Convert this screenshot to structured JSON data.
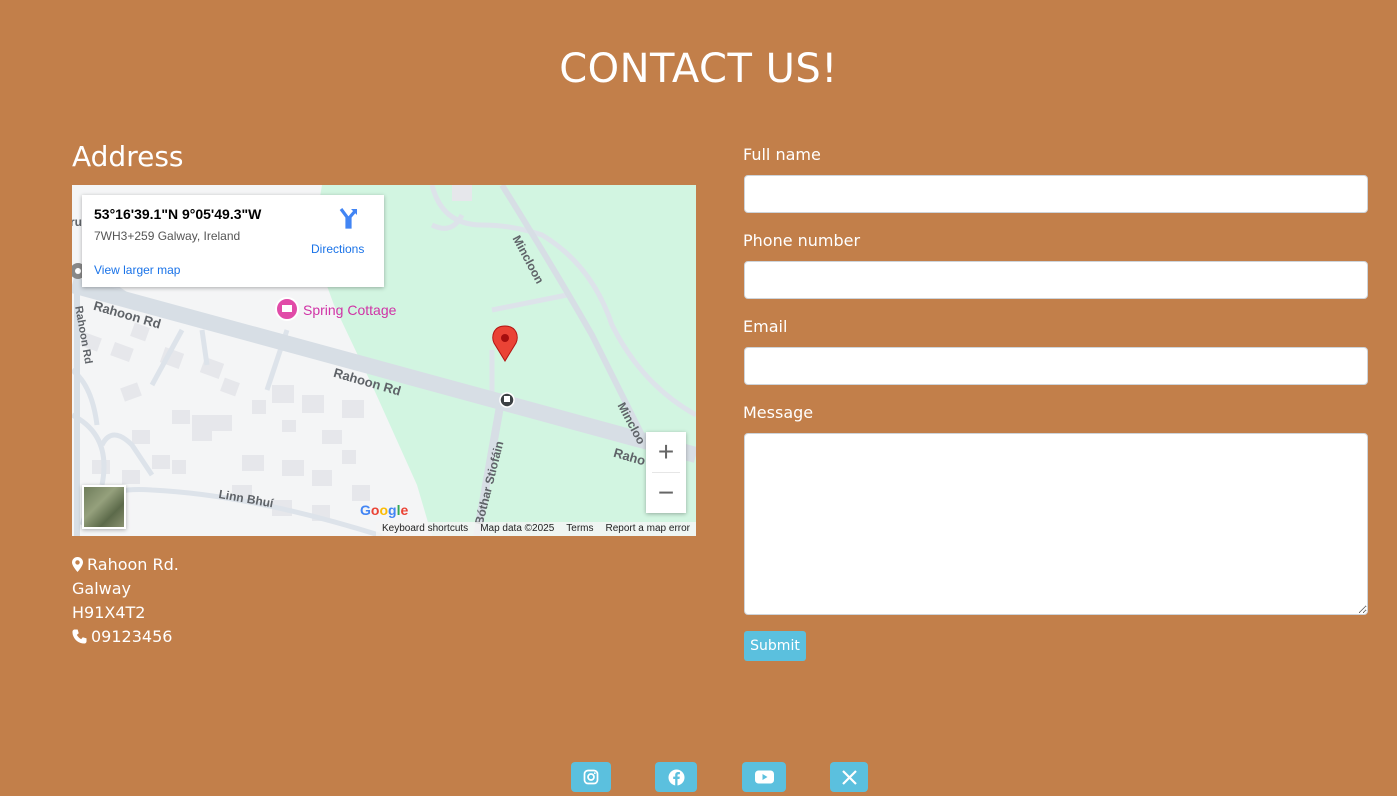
{
  "page": {
    "title": "CONTACT US!"
  },
  "address": {
    "heading": "Address",
    "street": "Rahoon Rd.",
    "city": "Galway",
    "postcode": "H91X4T2",
    "phone": "09123456"
  },
  "map": {
    "card": {
      "coords": "53°16'39.1\"N 9°05'49.3\"W",
      "plus_code": "7WH3+259 Galway, Ireland",
      "larger_map": "View larger map",
      "directions": "Directions"
    },
    "labels": {
      "poi": "Spring Cottage",
      "road_left": "Rahoon Rd",
      "road_mid": "Rahoon Rd",
      "road_right": "Raho",
      "mincloon_top": "Mincloon",
      "mincloon_right": "Mincloo",
      "bothar": "Bóthar Stiofáin",
      "linn": "Linn Bhuí",
      "left_road": "Rahoon Rd",
      "partial_top": "ru"
    },
    "zoom_in": "+",
    "zoom_out": "−",
    "google": [
      "G",
      "o",
      "o",
      "g",
      "l",
      "e"
    ],
    "footer": {
      "shortcuts": "Keyboard shortcuts",
      "data": "Map data ©2025",
      "terms": "Terms",
      "report": "Report a map error"
    }
  },
  "form": {
    "full_name_label": "Full name",
    "full_name_value": "",
    "phone_label": "Phone number",
    "phone_value": "",
    "email_label": "Email",
    "email_value": "",
    "message_label": "Message",
    "message_value": "",
    "submit_label": "Submit"
  },
  "social": [
    {
      "icon": "instagram-icon"
    },
    {
      "icon": "facebook-icon"
    },
    {
      "icon": "youtube-icon"
    },
    {
      "icon": "x-twitter-icon"
    }
  ],
  "colors": {
    "background": "#c27f4a",
    "button": "#5bc0de",
    "pin": "#ea4335",
    "poi": "#d033a6"
  }
}
